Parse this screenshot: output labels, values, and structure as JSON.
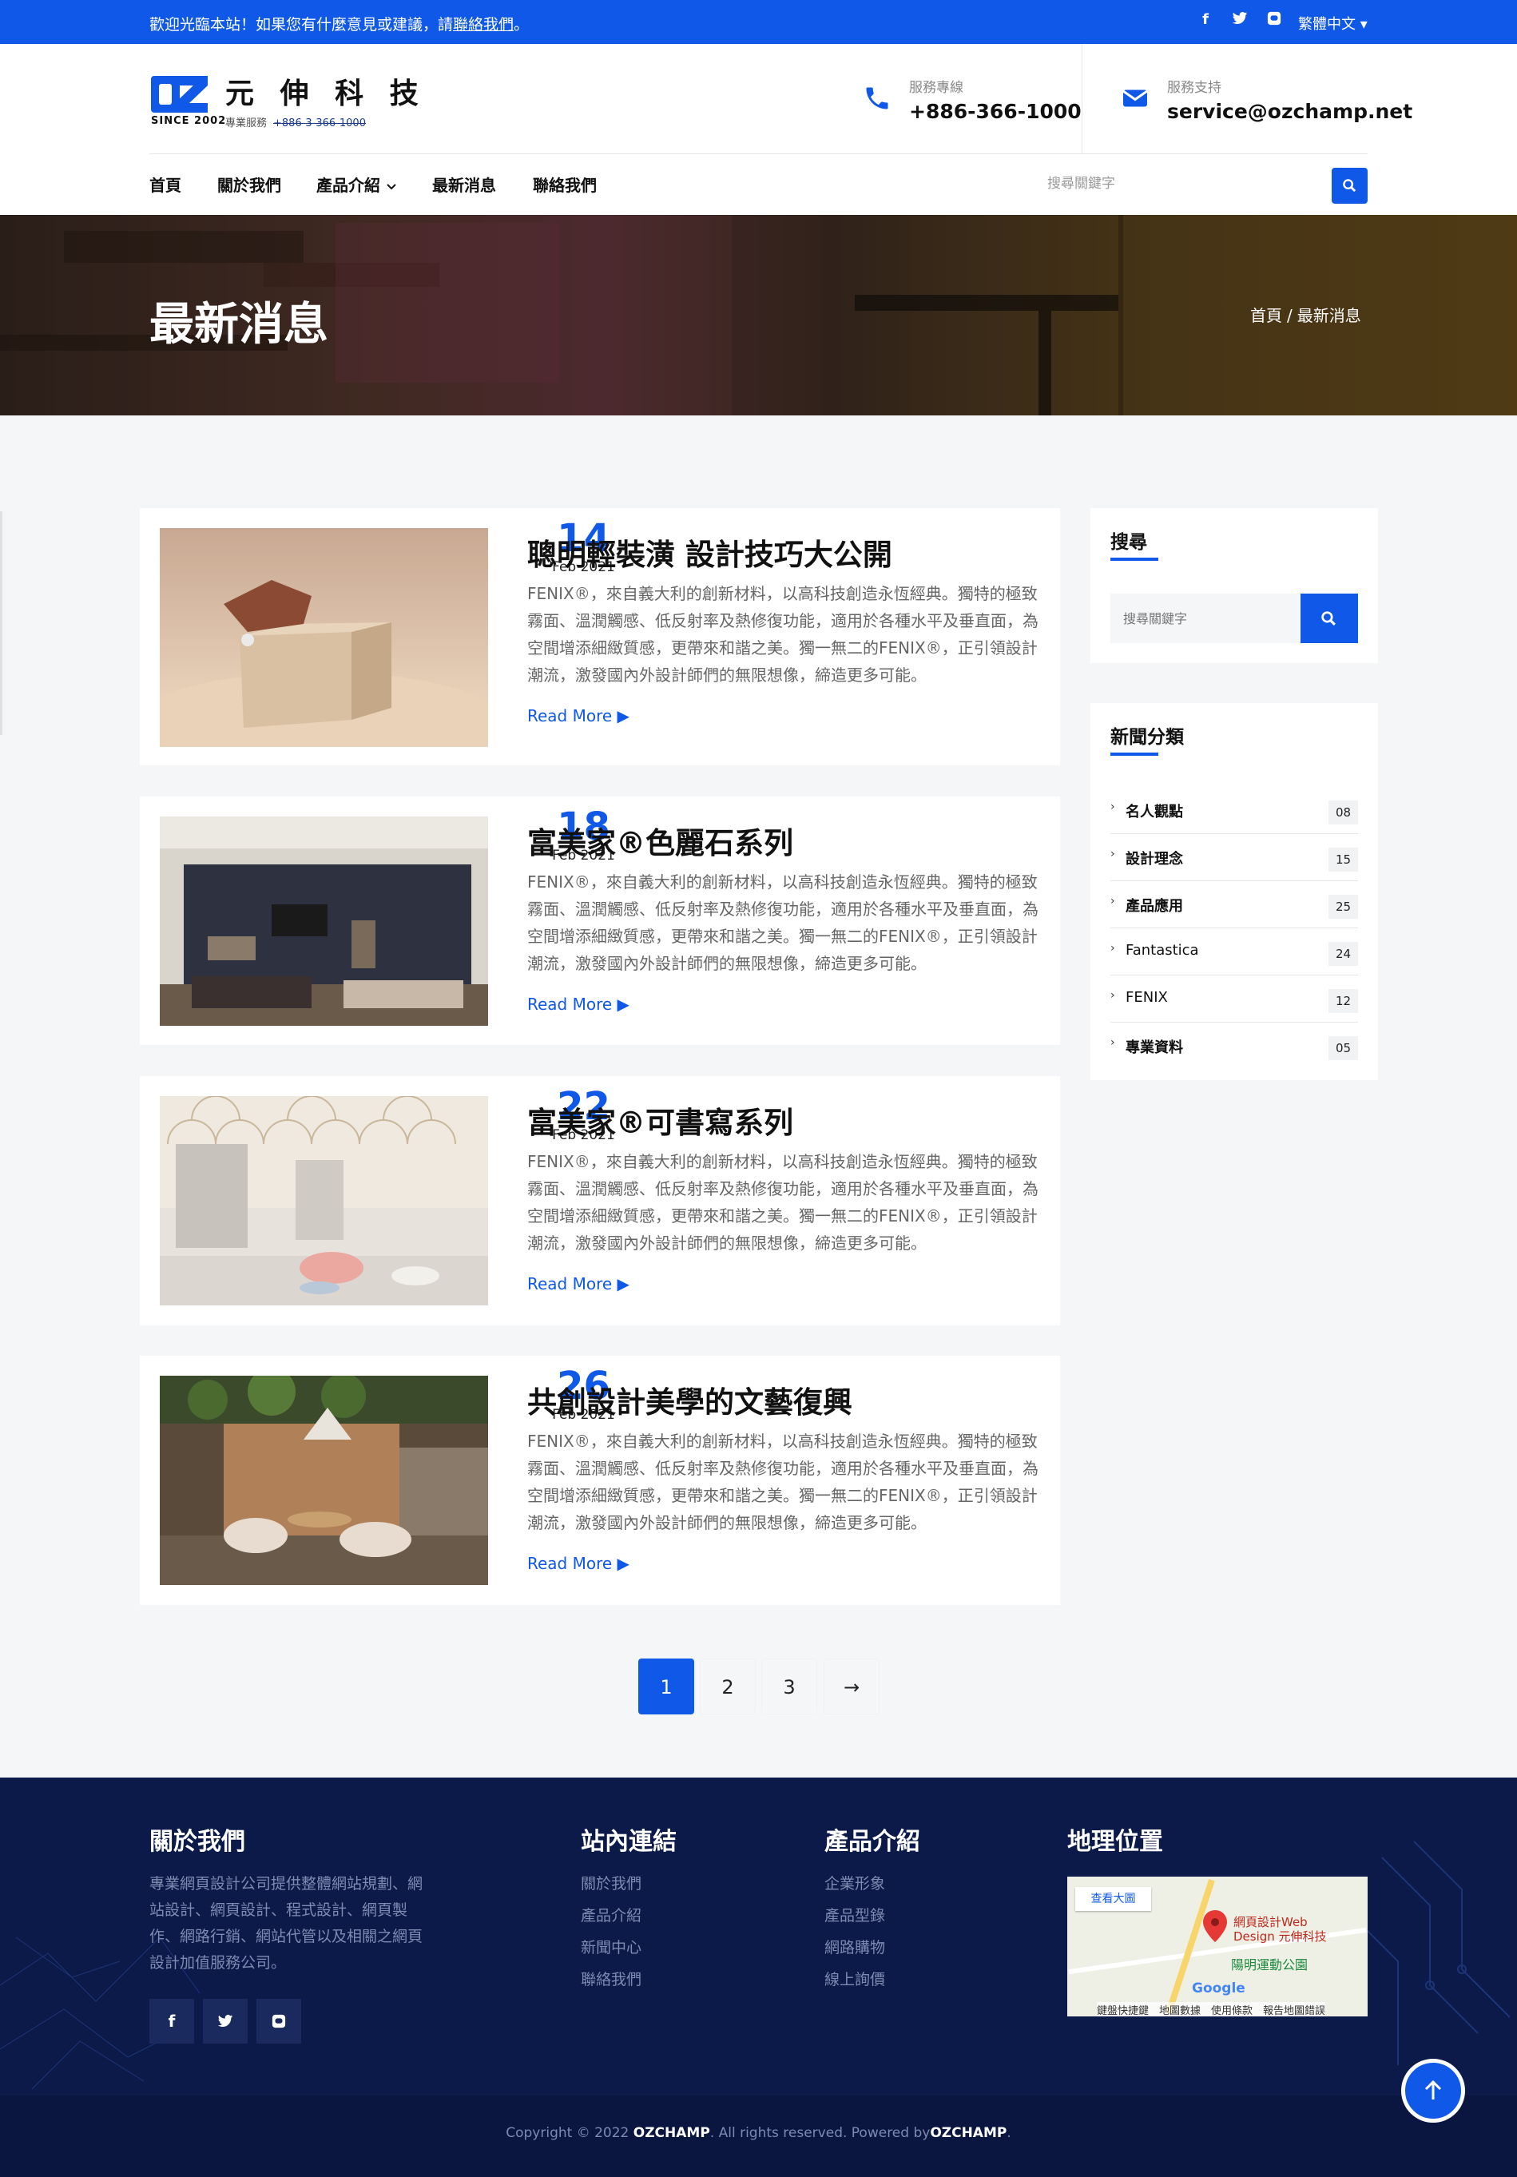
{
  "topbar": {
    "welcome_prefix": "歡迎光臨本站！如果您有什麼意見或建議，請",
    "welcome_link": "聯絡我們",
    "welcome_suffix": "。",
    "social": [
      "f",
      "t",
      "L"
    ],
    "language": "繁體中文 ▾"
  },
  "header": {
    "logo_name": "元 伸 科 技",
    "logo_since": "SINCE 2002",
    "logo_sub_label": "專業服務",
    "logo_sub_phone": "+886-3-366-1000",
    "phone_label": "服務專線",
    "phone_value": "+886-366-1000",
    "email_label": "服務支持",
    "email_value": "service@ozchamp.net"
  },
  "nav": {
    "items": [
      "首頁",
      "關於我們",
      "產品介紹",
      "最新消息",
      "聯絡我們"
    ],
    "search_placeholder": "搜尋關鍵字"
  },
  "hero": {
    "title": "最新消息",
    "breadcrumb_home": "首頁",
    "breadcrumb_sep": "/",
    "breadcrumb_current": "最新消息"
  },
  "posts": [
    {
      "day": "14",
      "month": "Feb 2021",
      "title": "聰明輕裝潢 設計技巧大公開",
      "excerpt": "FENIX®，來自義大利的創新材料，以高科技創造永恆經典。獨特的極致霧面、溫潤觸感、低反射率及熱修復功能，適用於各種水平及垂直面，為空間增添細緻質感，更帶來和諧之美。獨一無二的FENIX®，正引領設計潮流，激發國內外設計師們的無限想像，締造更多可能。",
      "more": "Read More ▶"
    },
    {
      "day": "18",
      "month": "Feb 2021",
      "title": "富美家®色麗石系列",
      "excerpt": "FENIX®，來自義大利的創新材料，以高科技創造永恆經典。獨特的極致霧面、溫潤觸感、低反射率及熱修復功能，適用於各種水平及垂直面，為空間增添細緻質感，更帶來和諧之美。獨一無二的FENIX®，正引領設計潮流，激發國內外設計師們的無限想像，締造更多可能。",
      "more": "Read More ▶"
    },
    {
      "day": "22",
      "month": "Feb 2021",
      "title": "富美家®可書寫系列",
      "excerpt": "FENIX®，來自義大利的創新材料，以高科技創造永恆經典。獨特的極致霧面、溫潤觸感、低反射率及熱修復功能，適用於各種水平及垂直面，為空間增添細緻質感，更帶來和諧之美。獨一無二的FENIX®，正引領設計潮流，激發國內外設計師們的無限想像，締造更多可能。",
      "more": "Read More ▶"
    },
    {
      "day": "26",
      "month": "Feb 2021",
      "title": "共創設計美學的文藝復興",
      "excerpt": "FENIX®，來自義大利的創新材料，以高科技創造永恆經典。獨特的極致霧面、溫潤觸感、低反射率及熱修復功能，適用於各種水平及垂直面，為空間增添細緻質感，更帶來和諧之美。獨一無二的FENIX®，正引領設計潮流，激發國內外設計師們的無限想像，締造更多可能。",
      "more": "Read More ▶"
    }
  ],
  "sidebar": {
    "search_title": "搜尋",
    "search_placeholder": "搜尋關鍵字",
    "categories_title": "新聞分類",
    "categories": [
      {
        "name": "名人觀點",
        "count": "08"
      },
      {
        "name": "設計理念",
        "count": "15"
      },
      {
        "name": "產品應用",
        "count": "25"
      },
      {
        "name": "Fantastica",
        "count": "24"
      },
      {
        "name": "FENIX",
        "count": "12"
      },
      {
        "name": "專業資料",
        "count": "05"
      }
    ]
  },
  "pagination": {
    "pages": [
      "1",
      "2",
      "3"
    ],
    "next": "→"
  },
  "footer": {
    "about_title": "關於我們",
    "about_text": "專業網頁設計公司提供整體網站規劃、網站設計、網頁設計、程式設計、網頁製作、網路行銷、網站代管以及相關之網頁設計加值服務公司。",
    "links_title": "站內連結",
    "links": [
      "關於我們",
      "產品介紹",
      "新聞中心",
      "聯絡我們"
    ],
    "products_title": "產品介紹",
    "products": [
      "企業形象",
      "產品型錄",
      "網路購物",
      "線上詢價"
    ],
    "location_title": "地理位置",
    "map_button": "查看大圖",
    "map_label": "網頁設計Web Design 元伸科技",
    "map_park": "陽明運動公園",
    "map_google": "Google",
    "map_terms": "鍵盤快捷鍵　地圖數據　使用條款　報告地圖錯誤",
    "social": [
      "f",
      "t",
      "L"
    ],
    "copyright_prefix": "Copyright © 2022 ",
    "copyright_brand": "OZCHAMP",
    "copyright_mid": ". All rights reserved. Powered by",
    "copyright_brand2": "OZCHAMP",
    "copyright_end": "."
  },
  "colors": {
    "primary": "#1059e8",
    "footer_bg": "#0c1a4a",
    "page_bg": "#f5f6f8"
  },
  "icons": [
    "facebook-icon",
    "twitter-icon",
    "line-icon",
    "phone-icon",
    "mail-icon",
    "search-icon",
    "chevron-down-icon",
    "chevron-right-icon",
    "arrow-right-icon",
    "arrow-up-icon",
    "map-pin-icon"
  ]
}
